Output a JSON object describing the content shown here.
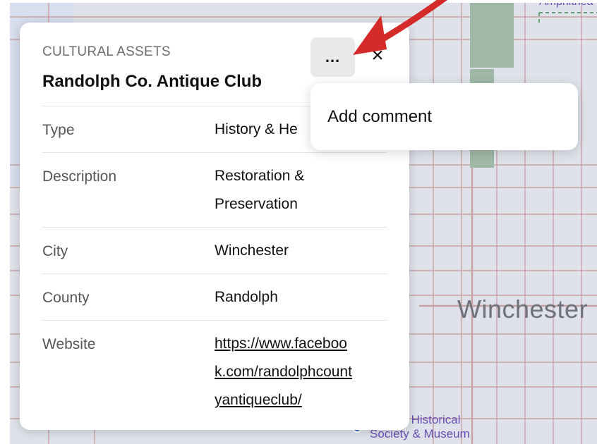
{
  "map": {
    "city_label": "Winchester",
    "poi_label_line1": "lph Co. Historical",
    "poi_label_line2": "Society & Museum",
    "amph_label": "Amphithea",
    "colors": {
      "land": "#dfe2ea",
      "roads": "#c9a3a3",
      "park": "#9fb8a7",
      "water": "#d3dcee"
    }
  },
  "card": {
    "category": "CULTURAL ASSETS",
    "title": "Randolph Co. Antique Club",
    "more_label": "...",
    "close_label": "×",
    "fields": [
      {
        "key": "Type",
        "value": "History & He"
      },
      {
        "key": "Description",
        "value_line1": "Restoration &",
        "value_line2": "Preservation"
      },
      {
        "key": "City",
        "value": "Winchester"
      },
      {
        "key": "County",
        "value": "Randolph"
      },
      {
        "key": "Website",
        "value_line1": "https://www.faceboo",
        "value_line2": "k.com/randolphcount",
        "value_line3": "yantiqueclub/"
      }
    ]
  },
  "menu": {
    "items": [
      {
        "label": "Add comment"
      }
    ]
  },
  "annotation": {
    "color": "#d42a2a"
  }
}
